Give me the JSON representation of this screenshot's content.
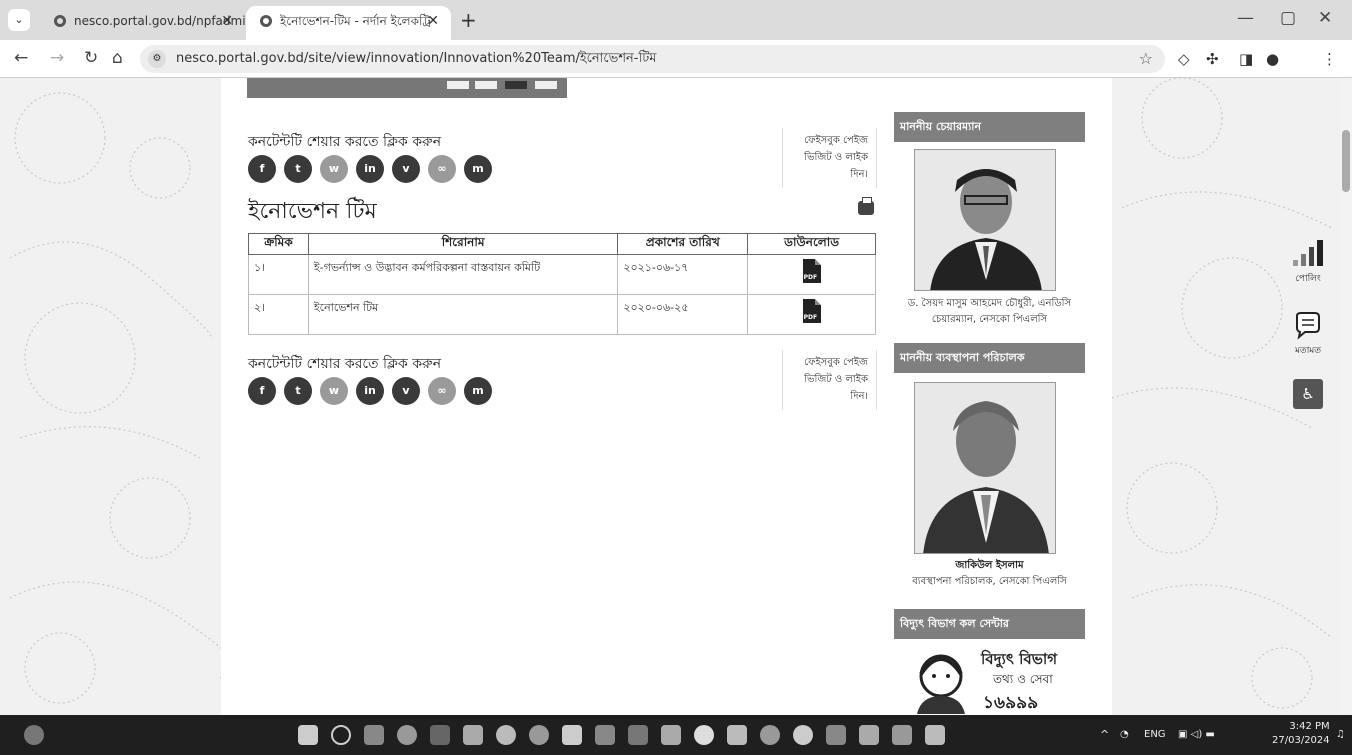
{
  "browser": {
    "tabs": [
      {
        "title": "nesco.portal.gov.bd/npfadmin/"
      },
      {
        "title": "ইনোভেশন-টিম - নর্দান ইলেকট্রি"
      }
    ],
    "new_tab": "+",
    "url": "nesco.portal.gov.bd/site/view/innovation/Innovation%20Team/ইনোভেশন-টিম"
  },
  "content": {
    "share_top": {
      "title": "কনটেন্টটি শেয়ার করতে ক্লিক করুন",
      "fb_box": [
        "ফেইসবুক পেইজ",
        "ভিজিট ও লাইক",
        "দিন।"
      ]
    },
    "share_bottom": {
      "title": "কনটেন্টটি শেয়ার করতে ক্লিক করুন",
      "fb_box": [
        "ফেইসবুক পেইজ",
        "ভিজিট ও লাইক",
        "দিন।"
      ]
    },
    "share_icons": [
      "facebook-icon",
      "twitter-icon",
      "whatsapp-icon",
      "linkedin-icon",
      "viber-icon",
      "link-icon",
      "messenger-icon"
    ],
    "page_title": "ইনোভেশন টিম",
    "table": {
      "headers": [
        "ক্রমিক",
        "শিরোনাম",
        "প্রকাশের তারিখ",
        "ডাউনলোড"
      ],
      "rows": [
        {
          "serial": "১।",
          "title": "ই-গভর্ন্যান্স ও উদ্ভাবন কর্মপরিকল্পনা বাস্তবায়ন কমিটি",
          "date": "২০২১-০৬-১৭",
          "download": "PDF"
        },
        {
          "serial": "২।",
          "title": "ইনোভেশন টিম",
          "date": "২০২০-০৬-২৫",
          "download": "PDF"
        }
      ]
    }
  },
  "sidebar": {
    "chairman": {
      "heading": "মাননীয় চেয়ারম্যান",
      "name": "ড. সৈয়দ মাসুম আহমেদ চৌধুরী, এনডিসি",
      "role": "চেয়ারম্যান, নেসকো পিএলসি"
    },
    "md": {
      "heading": "মাননীয় ব্যবস্থাপনা পরিচালক",
      "name": "জাকিউল ইসলাম",
      "role": "ব্যবস্থাপনা পরিচালক, নেসকো পিএলসি"
    },
    "callcenter": {
      "heading": "বিদ্যুৎ বিভাগ কল সেন্টার",
      "line1": "বিদ্যুৎ বিভাগ",
      "line2": "তথ্য ও সেবা",
      "number": "১৬৯৯৯"
    }
  },
  "float_tools": {
    "poll": "পোলিং",
    "feedback": "মতামত"
  },
  "taskbar": {
    "lang": "ENG",
    "time": "3:42 PM",
    "date": "27/03/2024"
  }
}
